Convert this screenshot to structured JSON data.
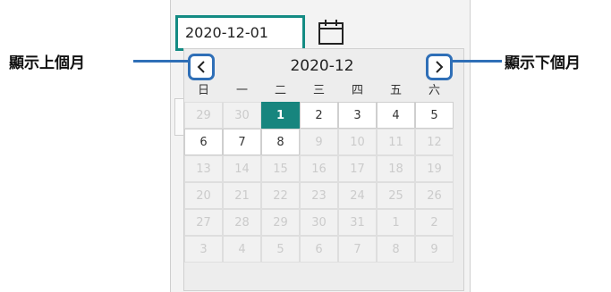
{
  "date_input": {
    "value": "2020-12-01"
  },
  "icons": {
    "calendar": "calendar-icon",
    "prev": "chevron-left-icon",
    "next": "chevron-right-icon"
  },
  "calendar": {
    "month_label": "2020-12",
    "weekdays": [
      "日",
      "一",
      "二",
      "三",
      "四",
      "五",
      "六"
    ],
    "weeks": [
      [
        {
          "d": "29",
          "enabled": false,
          "selected": false
        },
        {
          "d": "30",
          "enabled": false,
          "selected": false
        },
        {
          "d": "1",
          "enabled": true,
          "selected": true
        },
        {
          "d": "2",
          "enabled": true,
          "selected": false
        },
        {
          "d": "3",
          "enabled": true,
          "selected": false
        },
        {
          "d": "4",
          "enabled": true,
          "selected": false
        },
        {
          "d": "5",
          "enabled": true,
          "selected": false
        }
      ],
      [
        {
          "d": "6",
          "enabled": true,
          "selected": false
        },
        {
          "d": "7",
          "enabled": true,
          "selected": false
        },
        {
          "d": "8",
          "enabled": true,
          "selected": false
        },
        {
          "d": "9",
          "enabled": false,
          "selected": false
        },
        {
          "d": "10",
          "enabled": false,
          "selected": false
        },
        {
          "d": "11",
          "enabled": false,
          "selected": false
        },
        {
          "d": "12",
          "enabled": false,
          "selected": false
        }
      ],
      [
        {
          "d": "13",
          "enabled": false,
          "selected": false
        },
        {
          "d": "14",
          "enabled": false,
          "selected": false
        },
        {
          "d": "15",
          "enabled": false,
          "selected": false
        },
        {
          "d": "16",
          "enabled": false,
          "selected": false
        },
        {
          "d": "17",
          "enabled": false,
          "selected": false
        },
        {
          "d": "18",
          "enabled": false,
          "selected": false
        },
        {
          "d": "19",
          "enabled": false,
          "selected": false
        }
      ],
      [
        {
          "d": "20",
          "enabled": false,
          "selected": false
        },
        {
          "d": "21",
          "enabled": false,
          "selected": false
        },
        {
          "d": "22",
          "enabled": false,
          "selected": false
        },
        {
          "d": "23",
          "enabled": false,
          "selected": false
        },
        {
          "d": "24",
          "enabled": false,
          "selected": false
        },
        {
          "d": "25",
          "enabled": false,
          "selected": false
        },
        {
          "d": "26",
          "enabled": false,
          "selected": false
        }
      ],
      [
        {
          "d": "27",
          "enabled": false,
          "selected": false
        },
        {
          "d": "28",
          "enabled": false,
          "selected": false
        },
        {
          "d": "29",
          "enabled": false,
          "selected": false
        },
        {
          "d": "30",
          "enabled": false,
          "selected": false
        },
        {
          "d": "31",
          "enabled": false,
          "selected": false
        },
        {
          "d": "1",
          "enabled": false,
          "selected": false
        },
        {
          "d": "2",
          "enabled": false,
          "selected": false
        }
      ],
      [
        {
          "d": "3",
          "enabled": false,
          "selected": false
        },
        {
          "d": "4",
          "enabled": false,
          "selected": false
        },
        {
          "d": "5",
          "enabled": false,
          "selected": false
        },
        {
          "d": "6",
          "enabled": false,
          "selected": false
        },
        {
          "d": "7",
          "enabled": false,
          "selected": false
        },
        {
          "d": "8",
          "enabled": false,
          "selected": false
        },
        {
          "d": "9",
          "enabled": false,
          "selected": false
        }
      ]
    ]
  },
  "annotations": {
    "prev_label": "顯示上個月",
    "next_label": "顯示下個月",
    "line_color": "#2f6fb7"
  },
  "colors": {
    "input_border": "#138b83",
    "selected_day_bg": "#17857e",
    "nav_border": "#2f6fb7"
  }
}
